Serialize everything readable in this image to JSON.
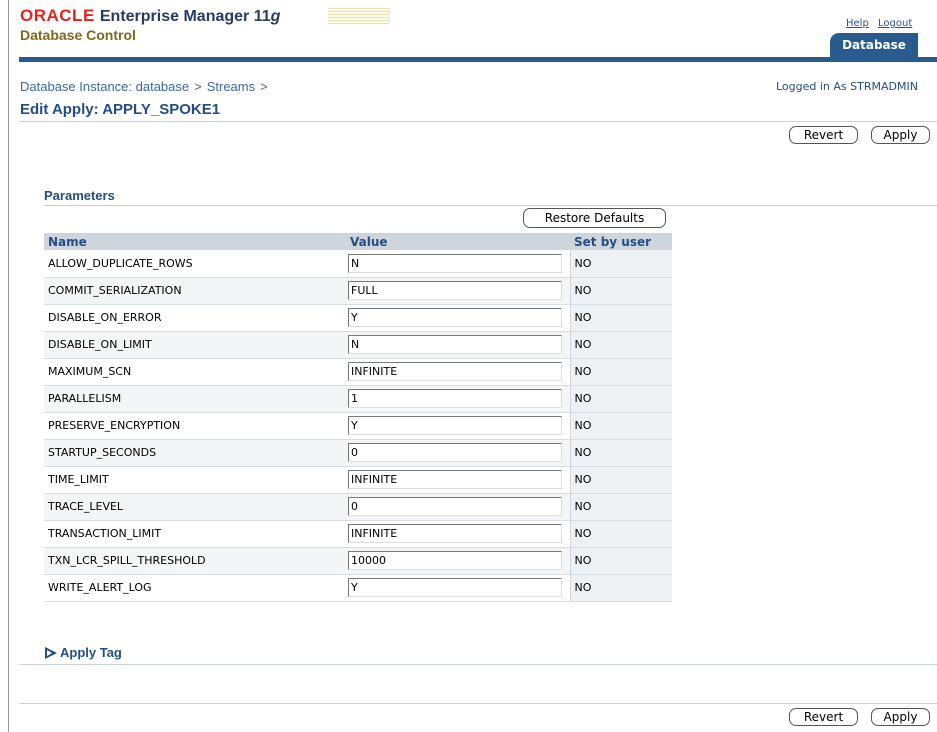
{
  "header": {
    "brand": "ORACLE",
    "product": "Enterprise Manager 11",
    "product_suffix": "g",
    "subtitle": "Database Control",
    "help_label": "Help",
    "logout_label": "Logout",
    "tab_label": "Database"
  },
  "breadcrumb": {
    "items": [
      "Database Instance: database",
      "Streams"
    ],
    "separator": ">"
  },
  "logged_in": "Logged in As STRMADMIN",
  "page_title": "Edit Apply: APPLY_SPOKE1",
  "buttons": {
    "revert": "Revert",
    "apply": "Apply",
    "restore_defaults": "Restore Defaults"
  },
  "parameters": {
    "section_title": "Parameters",
    "columns": [
      "Name",
      "Value",
      "Set by user"
    ],
    "rows": [
      {
        "name": "ALLOW_DUPLICATE_ROWS",
        "value": "N",
        "set_by_user": "NO"
      },
      {
        "name": "COMMIT_SERIALIZATION",
        "value": "FULL",
        "set_by_user": "NO"
      },
      {
        "name": "DISABLE_ON_ERROR",
        "value": "Y",
        "set_by_user": "NO"
      },
      {
        "name": "DISABLE_ON_LIMIT",
        "value": "N",
        "set_by_user": "NO"
      },
      {
        "name": "MAXIMUM_SCN",
        "value": "INFINITE",
        "set_by_user": "NO"
      },
      {
        "name": "PARALLELISM",
        "value": "1",
        "set_by_user": "NO"
      },
      {
        "name": "PRESERVE_ENCRYPTION",
        "value": "Y",
        "set_by_user": "NO"
      },
      {
        "name": "STARTUP_SECONDS",
        "value": "0",
        "set_by_user": "NO"
      },
      {
        "name": "TIME_LIMIT",
        "value": "INFINITE",
        "set_by_user": "NO"
      },
      {
        "name": "TRACE_LEVEL",
        "value": "0",
        "set_by_user": "NO"
      },
      {
        "name": "TRANSACTION_LIMIT",
        "value": "INFINITE",
        "set_by_user": "NO"
      },
      {
        "name": "TXN_LCR_SPILL_THRESHOLD",
        "value": "10000",
        "set_by_user": "NO"
      },
      {
        "name": "WRITE_ALERT_LOG",
        "value": "Y",
        "set_by_user": "NO"
      }
    ]
  },
  "apply_tag": {
    "label": "Apply Tag"
  },
  "colors": {
    "brand_red": "#e5231b",
    "accent_blue": "#2a5b8e",
    "link_blue": "#3f67a6",
    "header_gold": "#7a6a1e"
  }
}
